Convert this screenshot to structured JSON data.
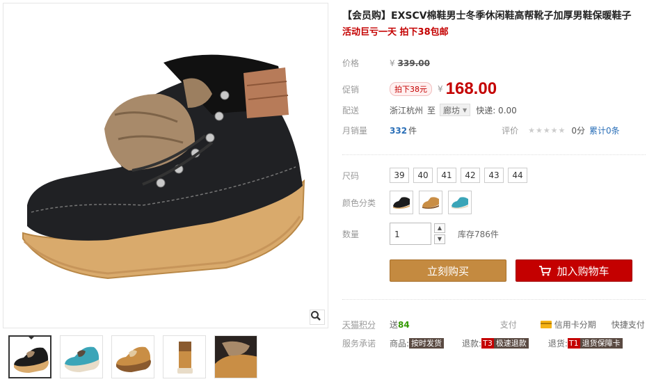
{
  "product": {
    "title": "【会员购】EXSCV棉鞋男士冬季休闲鞋高帮靴子加厚男鞋保暖鞋子",
    "subtitle": "活动巨亏一天 拍下38包邮"
  },
  "price": {
    "original_label": "价格",
    "currency": "¥",
    "original_value": "339.00",
    "promo_label": "促销",
    "promo_tag": "拍下38元",
    "promo_value": "168.00"
  },
  "shipping": {
    "label": "配送",
    "from": "浙江杭州",
    "to_word": "至",
    "destination": "廊坊",
    "express": "快递: 0.00"
  },
  "sales": {
    "label": "月销量",
    "count": "332",
    "unit": "件",
    "rating_label": "评价",
    "stars": "★★★★★",
    "score": "0分",
    "reviews": "累计0条"
  },
  "size": {
    "label": "尺码",
    "options": [
      "39",
      "40",
      "41",
      "42",
      "43",
      "44"
    ]
  },
  "color": {
    "label": "颜色分类",
    "swatches": [
      "black",
      "tan",
      "teal"
    ]
  },
  "quantity": {
    "label": "数量",
    "value": "1",
    "stock": "库存786件"
  },
  "buttons": {
    "buy": "立刻购买",
    "cart": "加入购物车"
  },
  "points": {
    "label": "天猫积分",
    "prefix": "送",
    "value": "84",
    "pay_label": "支付",
    "credit": "信用卡分期",
    "quick_pay": "快捷支付"
  },
  "service": {
    "label": "服务承诺",
    "goods_label": "商品:",
    "goods_tag": "按时发货",
    "refund_label": "退款:",
    "refund_code": "T3",
    "refund_tag": "极速退款",
    "return_label": "退货:",
    "return_code": "T1",
    "return_tag": "退货保障卡"
  },
  "colors": {
    "accent_red": "#c40000",
    "buy_button": "#c48a40",
    "link_blue": "#2a6fb8"
  }
}
